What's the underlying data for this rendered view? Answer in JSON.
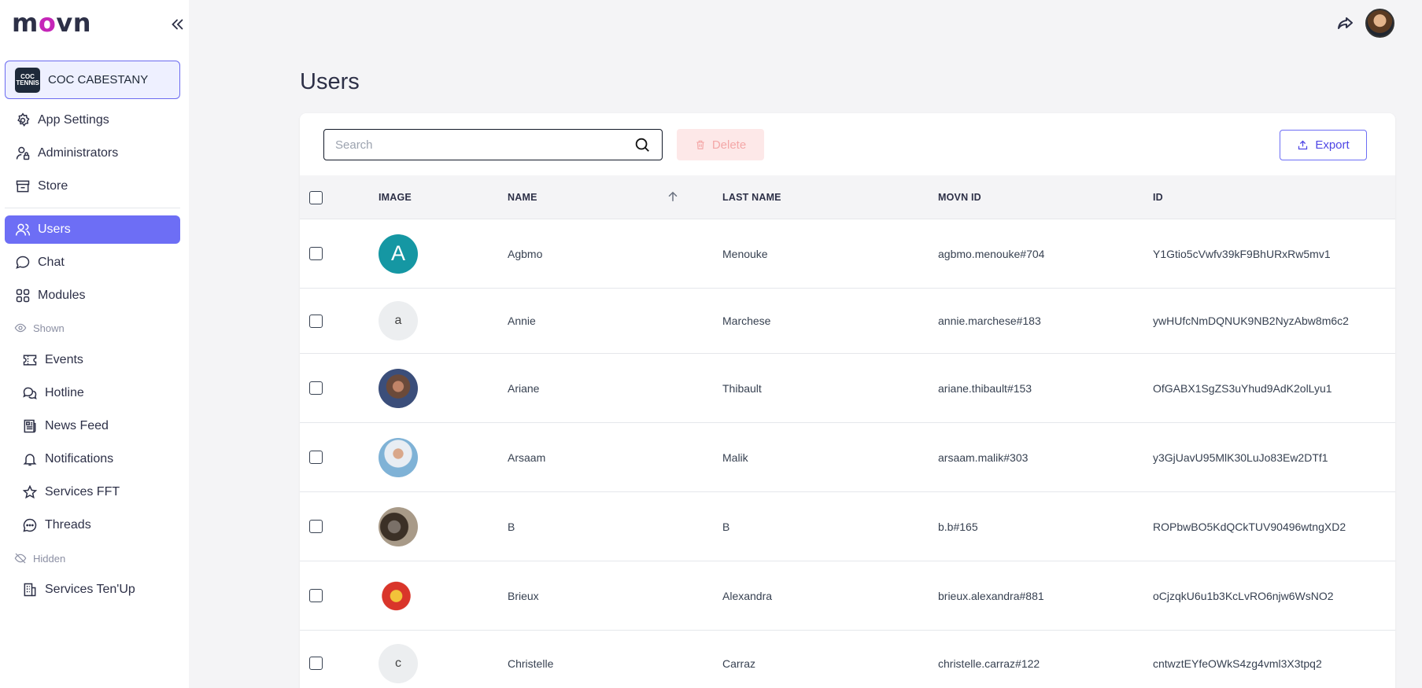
{
  "app": {
    "logo_prefix": "m",
    "logo_accent": "o",
    "logo_suffix": "vn"
  },
  "org": {
    "name": "COC CABESTANY",
    "logo_text": "COC TENNIS"
  },
  "nav": {
    "app_settings": "App Settings",
    "administrators": "Administrators",
    "store": "Store",
    "users": "Users",
    "chat": "Chat",
    "modules": "Modules",
    "shown_label": "Shown",
    "events": "Events",
    "hotline": "Hotline",
    "news_feed": "News Feed",
    "notifications": "Notifications",
    "services_fft": "Services FFT",
    "threads": "Threads",
    "hidden_label": "Hidden",
    "services_tenup": "Services Ten'Up"
  },
  "page": {
    "title": "Users"
  },
  "toolbar": {
    "search_placeholder": "Search",
    "delete_label": "Delete",
    "export_label": "Export"
  },
  "table": {
    "headers": {
      "image": "IMAGE",
      "name": "NAME",
      "last_name": "LAST NAME",
      "movn_id": "MOVN ID",
      "id": "ID"
    },
    "rows": [
      {
        "avatar": "A",
        "name": "Agbmo",
        "last_name": "Menouke",
        "movn_id": "agbmo.menouke#704",
        "id": "Y1Gtio5cVwfv39kF9BhURxRw5mv1"
      },
      {
        "avatar": "a",
        "name": "Annie",
        "last_name": "Marchese",
        "movn_id": "annie.marchese#183",
        "id": "ywHUfcNmDQNUK9NB2NyzAbw8m6c2"
      },
      {
        "avatar": "",
        "name": "Ariane",
        "last_name": "Thibault",
        "movn_id": "ariane.thibault#153",
        "id": "OfGABX1SgZS3uYhud9AdK2olLyu1"
      },
      {
        "avatar": "",
        "name": "Arsaam",
        "last_name": "Malik",
        "movn_id": "arsaam.malik#303",
        "id": "y3GjUavU95MlK30LuJo83Ew2DTf1"
      },
      {
        "avatar": "",
        "name": "B",
        "last_name": "B",
        "movn_id": "b.b#165",
        "id": "ROPbwBO5KdQCkTUV90496wtngXD2"
      },
      {
        "avatar": "",
        "name": "Brieux",
        "last_name": "Alexandra",
        "movn_id": "brieux.alexandra#881",
        "id": "oCjzqkU6u1b3KcLvRO6njw6WsNO2"
      },
      {
        "avatar": "c",
        "name": "Christelle",
        "last_name": "Carraz",
        "movn_id": "christelle.carraz#122",
        "id": "cntwztEYfeOWkS4zg4vml3X3tpq2"
      }
    ]
  },
  "colors": {
    "accent": "#6d6ef5",
    "brand_magenta": "#c526b8",
    "teal_avatar": "#1597a3"
  }
}
